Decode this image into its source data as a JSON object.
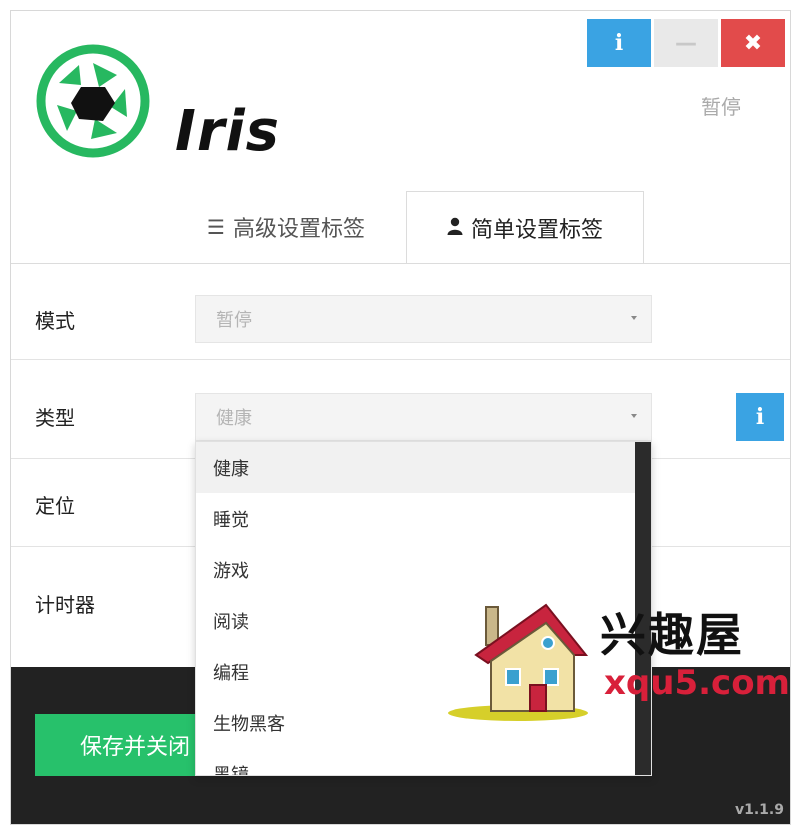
{
  "app": {
    "name": "Iris",
    "status": "暂停",
    "version": "v1.1.9"
  },
  "window_buttons": {
    "info": "i",
    "minimize": "—",
    "close": "✖"
  },
  "tabs": [
    {
      "label": "高级设置标签",
      "icon": "list-icon"
    },
    {
      "label": "简单设置标签",
      "icon": "user-icon",
      "active": true
    }
  ],
  "rows": {
    "mode": {
      "label": "模式",
      "value": "暂停"
    },
    "type": {
      "label": "类型",
      "value": "健康"
    },
    "location": {
      "label": "定位"
    },
    "timer": {
      "label": "计时器"
    }
  },
  "side_info": "i",
  "dropdown": {
    "items": [
      "健康",
      "睡觉",
      "游戏",
      "阅读",
      "编程",
      "生物黑客",
      "黑镜"
    ],
    "selected": "健康"
  },
  "footer": {
    "save_label": "保存并关闭"
  },
  "watermark": {
    "cn": "兴趣屋",
    "en": "xqu5.com"
  },
  "colors": {
    "accent": "#3aa3e3",
    "close": "#e24b4b",
    "save": "#27c16b",
    "logo": "#27b860",
    "footer": "#222222"
  }
}
